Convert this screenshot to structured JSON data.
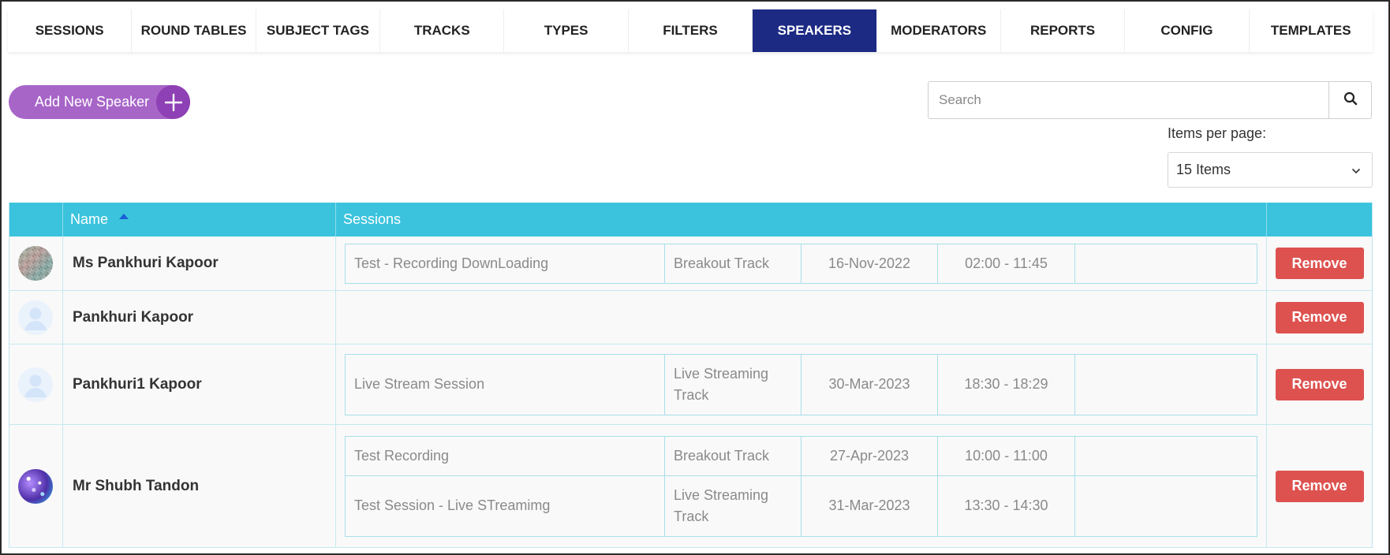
{
  "tabs": [
    {
      "label": "SESSIONS",
      "active": false
    },
    {
      "label": "ROUND TABLES",
      "active": false
    },
    {
      "label": "SUBJECT TAGS",
      "active": false
    },
    {
      "label": "TRACKS",
      "active": false
    },
    {
      "label": "TYPES",
      "active": false
    },
    {
      "label": "FILTERS",
      "active": false
    },
    {
      "label": "SPEAKERS",
      "active": true
    },
    {
      "label": "MODERATORS",
      "active": false
    },
    {
      "label": "REPORTS",
      "active": false
    },
    {
      "label": "CONFIG",
      "active": false
    },
    {
      "label": "TEMPLATES",
      "active": false
    }
  ],
  "toolbar": {
    "add_label": "Add New Speaker",
    "search_placeholder": "Search",
    "items_per_page_label": "Items per page:",
    "items_per_page_value": "15 Items"
  },
  "table": {
    "headers": {
      "name": "Name",
      "sessions": "Sessions"
    },
    "remove_label": "Remove",
    "rows": [
      {
        "name": "Ms Pankhuri Kapoor",
        "avatar": "photo",
        "sessions": [
          {
            "title": "Test - Recording DownLoading",
            "track": "Breakout Track",
            "date": "16-Nov-2022",
            "time": "02:00 - 11:45"
          }
        ]
      },
      {
        "name": "Pankhuri Kapoor",
        "avatar": "default-user-icon",
        "sessions": []
      },
      {
        "name": "Pankhuri1 Kapoor",
        "avatar": "default-user-icon",
        "sessions": [
          {
            "title": "Live Stream Session",
            "track": "Live Streaming Track",
            "date": "30-Mar-2023",
            "time": "18:30 - 18:29"
          }
        ]
      },
      {
        "name": "Mr Shubh Tandon",
        "avatar": "photo",
        "sessions": [
          {
            "title": "Test Recording",
            "track": "Breakout Track",
            "date": "27-Apr-2023",
            "time": "10:00 - 11:00"
          },
          {
            "title": "Test Session - Live STreamimg",
            "track": "Live Streaming Track",
            "date": "31-Mar-2023",
            "time": "13:30 - 14:30"
          }
        ]
      }
    ]
  },
  "colors": {
    "active_tab": "#1c2a84",
    "header": "#3bc3dd",
    "add_button": "#a765c8",
    "remove_button": "#dd524f"
  }
}
